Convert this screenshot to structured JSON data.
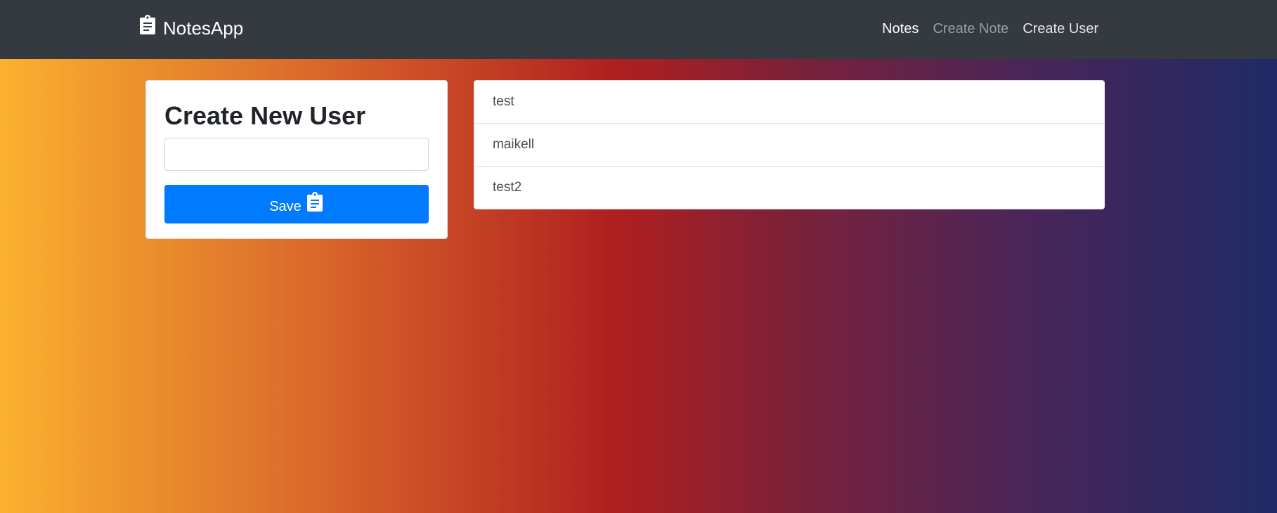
{
  "navbar": {
    "brand": "NotesApp",
    "brand_icon": "clipboard-icon",
    "links": [
      {
        "label": "Notes"
      },
      {
        "label": "Create Note"
      },
      {
        "label": "Create User"
      }
    ]
  },
  "form": {
    "title": "Create New User",
    "input_value": "",
    "save_label": "Save",
    "save_icon": "clipboard-icon",
    "button_color": "#007bff"
  },
  "users": [
    {
      "name": "test"
    },
    {
      "name": "maikell"
    },
    {
      "name": "test2"
    }
  ],
  "colors": {
    "navbar": "#343a40",
    "gradient": [
      "#fbb12f",
      "#b01f1f",
      "#1f2a66"
    ]
  }
}
